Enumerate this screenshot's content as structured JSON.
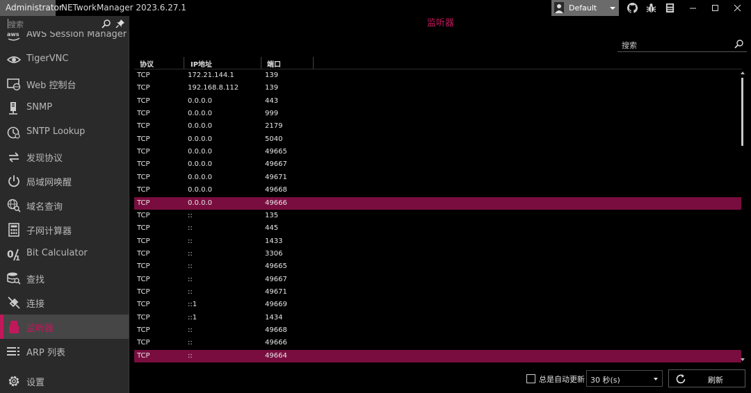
{
  "titlebar": {
    "user": "Administrator",
    "app_title": "NETworkManager 2023.6.27.1",
    "profile": "Default"
  },
  "sidebar": {
    "search_placeholder": "搜索",
    "items": [
      {
        "label": "AWS Session Manager",
        "icon": "aws-icon"
      },
      {
        "label": "TigerVNC",
        "icon": "eye-icon"
      },
      {
        "label": "Web 控制台",
        "icon": "web-console-icon"
      },
      {
        "label": "SNMP",
        "icon": "snmp-icon"
      },
      {
        "label": "SNTP Lookup",
        "icon": "clock-icon"
      },
      {
        "label": "发现协议",
        "icon": "swap-arrows-icon"
      },
      {
        "label": "局域网唤醒",
        "icon": "power-icon"
      },
      {
        "label": "域名查询",
        "icon": "globe-search-icon"
      },
      {
        "label": "子网计算器",
        "icon": "calculator-icon"
      },
      {
        "label": "Bit Calculator",
        "icon": "percent-icon"
      },
      {
        "label": "查找",
        "icon": "database-search-icon"
      },
      {
        "label": "连接",
        "icon": "connection-icon"
      },
      {
        "label": "监听器",
        "icon": "listener-icon",
        "active": true
      },
      {
        "label": "ARP 列表",
        "icon": "list-icon"
      },
      {
        "label": "设置",
        "icon": "gear-icon"
      }
    ]
  },
  "main": {
    "title": "监听器",
    "search_placeholder": "搜索",
    "columns": [
      "协议",
      "IP地址",
      "端口"
    ],
    "rows": [
      [
        "TCP",
        "172.21.144.1",
        "139"
      ],
      [
        "TCP",
        "192.168.8.112",
        "139"
      ],
      [
        "TCP",
        "0.0.0.0",
        "443"
      ],
      [
        "TCP",
        "0.0.0.0",
        "999"
      ],
      [
        "TCP",
        "0.0.0.0",
        "2179"
      ],
      [
        "TCP",
        "0.0.0.0",
        "5040"
      ],
      [
        "TCP",
        "0.0.0.0",
        "49665"
      ],
      [
        "TCP",
        "0.0.0.0",
        "49667"
      ],
      [
        "TCP",
        "0.0.0.0",
        "49671"
      ],
      [
        "TCP",
        "0.0.0.0",
        "49668"
      ],
      [
        "TCP",
        "0.0.0.0",
        "49666"
      ],
      [
        "TCP",
        "::",
        "135"
      ],
      [
        "TCP",
        "::",
        "445"
      ],
      [
        "TCP",
        "::",
        "1433"
      ],
      [
        "TCP",
        "::",
        "3306"
      ],
      [
        "TCP",
        "::",
        "49665"
      ],
      [
        "TCP",
        "::",
        "49667"
      ],
      [
        "TCP",
        "::",
        "49671"
      ],
      [
        "TCP",
        "::1",
        "49669"
      ],
      [
        "TCP",
        "::1",
        "1434"
      ],
      [
        "TCP",
        "::",
        "49668"
      ],
      [
        "TCP",
        "::",
        "49666"
      ],
      [
        "TCP",
        "::",
        "49664"
      ]
    ],
    "highlighted_rows": [
      10,
      22
    ],
    "auto_refresh_label": "总是自动更新",
    "auto_refresh_checked": false,
    "interval": "30 秒(s)",
    "refresh_label": "刷新"
  },
  "colors": {
    "accent": "#c2185b",
    "selected_row": "#7a0d3f",
    "sidebar_bg": "#2a2a2a"
  }
}
